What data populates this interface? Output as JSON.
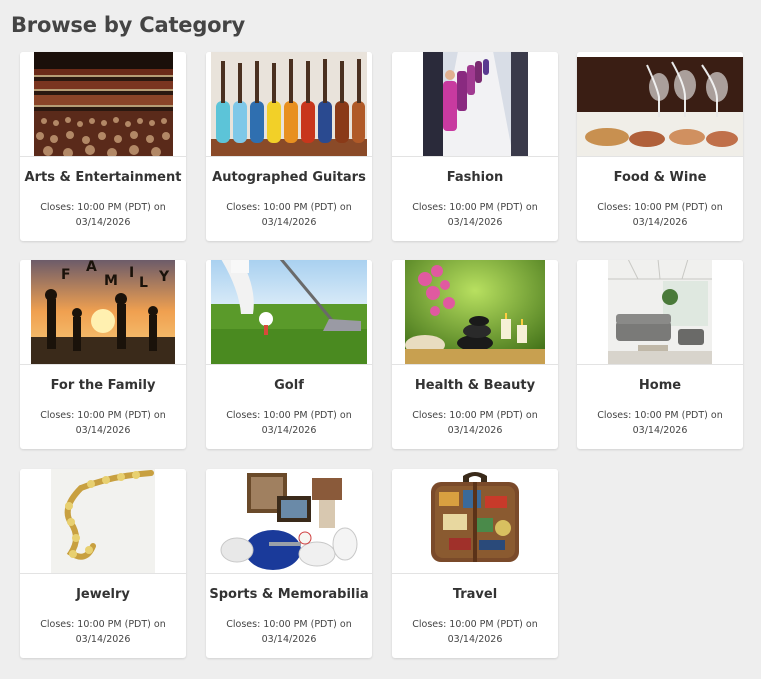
{
  "page": {
    "title": "Browse by Category"
  },
  "closes_prefix": "Closes: 10:00 PM (PDT) on",
  "categories": [
    {
      "name": "Arts & Entertainment",
      "date": "03/14/2026",
      "image": "theater-audience-photo"
    },
    {
      "name": "Autographed Guitars",
      "date": "03/14/2026",
      "image": "guitars-photo"
    },
    {
      "name": "Fashion",
      "date": "03/14/2026",
      "image": "runway-photo"
    },
    {
      "name": "Food & Wine",
      "date": "03/14/2026",
      "image": "wine-food-photo"
    },
    {
      "name": "For the Family",
      "date": "03/14/2026",
      "image": "family-sunset-photo"
    },
    {
      "name": "Golf",
      "date": "03/14/2026",
      "image": "golf-photo"
    },
    {
      "name": "Health & Beauty",
      "date": "03/14/2026",
      "image": "spa-photo"
    },
    {
      "name": "Home",
      "date": "03/14/2026",
      "image": "living-room-photo"
    },
    {
      "name": "Jewelry",
      "date": "03/14/2026",
      "image": "gold-necklace-photo"
    },
    {
      "name": "Sports & Memorabilia",
      "date": "03/14/2026",
      "image": "sports-memorabilia-photo"
    },
    {
      "name": "Travel",
      "date": "03/14/2026",
      "image": "suitcase-photo"
    }
  ]
}
